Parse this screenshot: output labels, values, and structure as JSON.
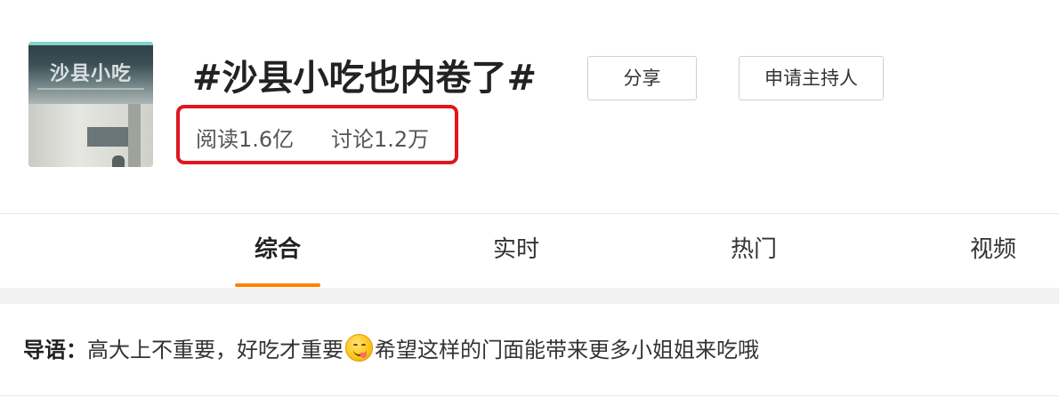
{
  "topic": {
    "title": "#沙县小吃也内卷了#",
    "thumbnail_sign": "沙县小吃",
    "share_label": "分享",
    "apply_host_label": "申请主持人",
    "stats": {
      "read": "阅读1.6亿",
      "discuss": "讨论1.2万"
    },
    "highlight_color": "#e0161e"
  },
  "tabs": [
    {
      "label": "综合",
      "active": true
    },
    {
      "label": "实时",
      "active": false
    },
    {
      "label": "热门",
      "active": false
    },
    {
      "label": "视频",
      "active": false
    }
  ],
  "active_tab_color": "#ff8200",
  "intro": {
    "label": "导语：",
    "text_before_emoji": "高大上不重要，好吃才重要",
    "emoji_icon": "smiley-tongue-icon",
    "text_after_emoji": "希望这样的门面能带来更多小姐姐来吃哦"
  }
}
